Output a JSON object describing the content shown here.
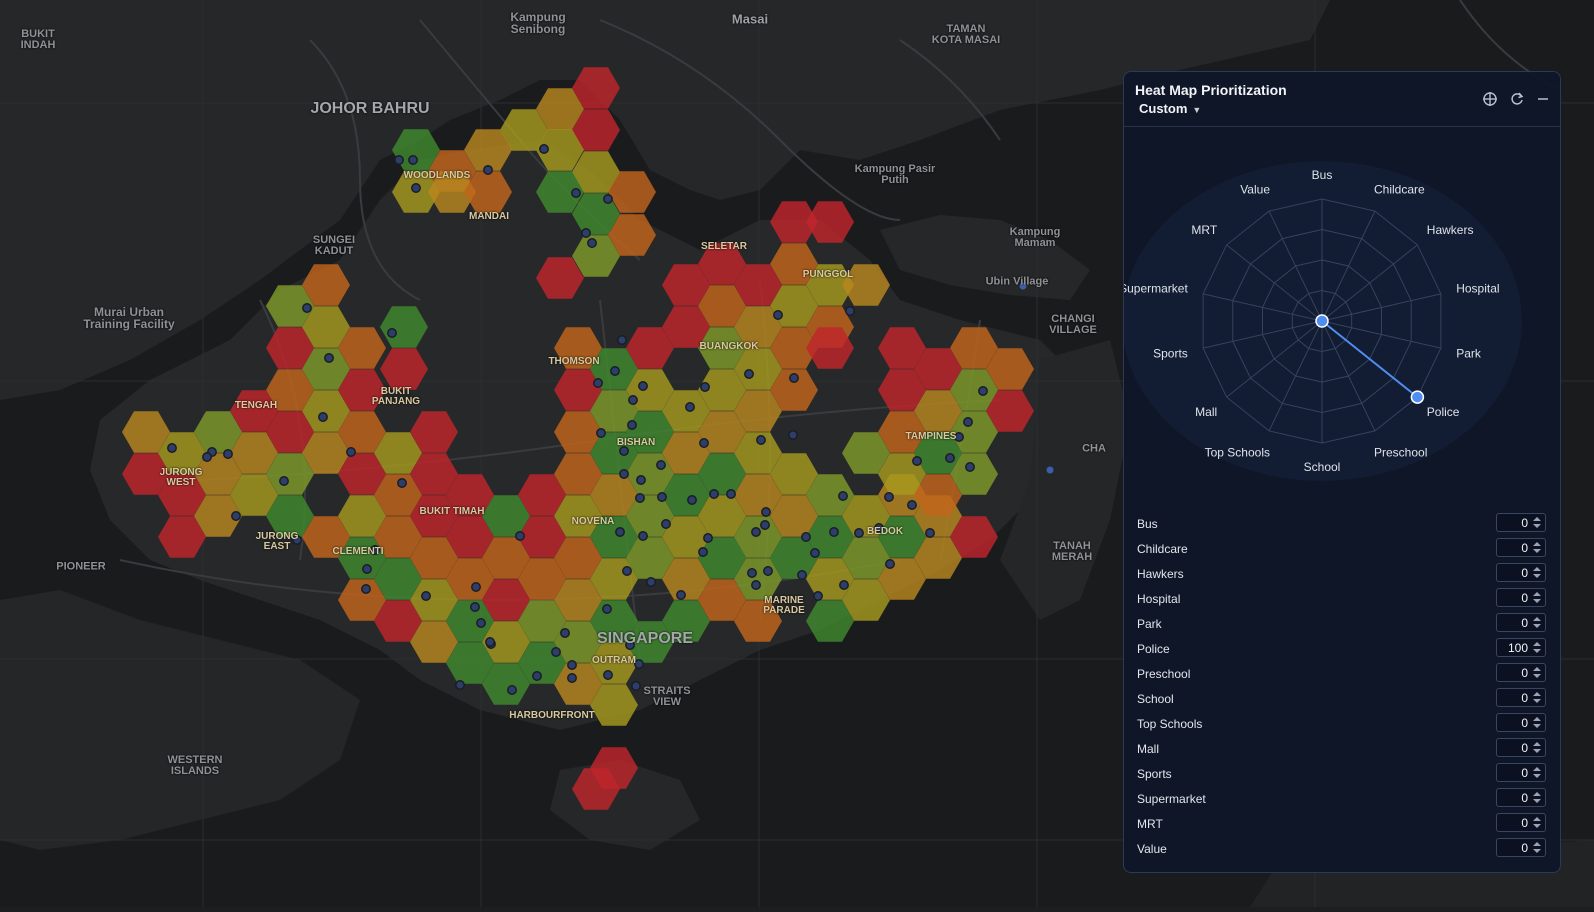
{
  "map": {
    "places": [
      {
        "key": "bukit_indah",
        "text": "BUKIT\nINDAH"
      },
      {
        "key": "kampung_senibong",
        "text": "Kampung\nSenibong"
      },
      {
        "key": "masai",
        "text": "Masai"
      },
      {
        "key": "taman_kota_masai",
        "text": "TAMAN\nKOTA MASAI"
      },
      {
        "key": "johor_bahru",
        "text": "JOHOR BAHRU"
      },
      {
        "key": "woodlands",
        "text": "WOODLANDS"
      },
      {
        "key": "mandai",
        "text": "MANDAI"
      },
      {
        "key": "kampung_pasir_putih",
        "text": "Kampung Pasir\nPutih"
      },
      {
        "key": "sungei_kadut",
        "text": "SUNGEI\nKADUT"
      },
      {
        "key": "seletar",
        "text": "SELETAR"
      },
      {
        "key": "kampung_mamam",
        "text": "Kampung\nMamam"
      },
      {
        "key": "punggol",
        "text": "PUNGGOL"
      },
      {
        "key": "ubin_village",
        "text": "Ubin Village"
      },
      {
        "key": "murai",
        "text": "Murai Urban\nTraining Facility"
      },
      {
        "key": "changi_village",
        "text": "CHANGI\nVILLAGE"
      },
      {
        "key": "thomson",
        "text": "THOMSON"
      },
      {
        "key": "buangkok",
        "text": "BUANGKOK"
      },
      {
        "key": "bukit_panjang",
        "text": "BUKIT\nPANJANG"
      },
      {
        "key": "tengah",
        "text": "TENGAH"
      },
      {
        "key": "bishan",
        "text": "BISHAN"
      },
      {
        "key": "tampines",
        "text": "TAMPINES"
      },
      {
        "key": "jurong_west",
        "text": "JURONG\nWEST"
      },
      {
        "key": "bukit_timah",
        "text": "BUKIT TIMAH"
      },
      {
        "key": "novena",
        "text": "NOVENA"
      },
      {
        "key": "bedok",
        "text": "BEDOK"
      },
      {
        "key": "jurong_east",
        "text": "JURONG\nEAST"
      },
      {
        "key": "clementi",
        "text": "CLEMENTI"
      },
      {
        "key": "tanah_merah",
        "text": "TANAH\nMERAH"
      },
      {
        "key": "pioneer",
        "text": "PIONEER"
      },
      {
        "key": "marine_parade",
        "text": "MARINE\nPARADE"
      },
      {
        "key": "singapore",
        "text": "SINGAPORE"
      },
      {
        "key": "outram",
        "text": "OUTRAM"
      },
      {
        "key": "straits_view",
        "text": "STRAITS\nVIEW"
      },
      {
        "key": "harbourfront",
        "text": "HARBOURFRONT"
      },
      {
        "key": "western_islands",
        "text": "WESTERN\nISLANDS"
      },
      {
        "key": "cha",
        "text": "CHA"
      }
    ],
    "colors": {
      "red": "#c0262c",
      "orange": "#c2651c",
      "amber": "#b8861e",
      "yellow": "#a69a1f",
      "lime": "#7f9a2a",
      "green": "#3f8a2e",
      "marker": "#3b5fa8"
    }
  },
  "panel": {
    "title": "Heat Map Prioritization",
    "preset": "Custom",
    "icons": {
      "target": "crosshair-icon",
      "reset": "reset-icon",
      "minimize": "minimize-icon"
    },
    "radar_color": "#4f8df0",
    "criteria": [
      {
        "label": "Bus",
        "value": 0
      },
      {
        "label": "Childcare",
        "value": 0
      },
      {
        "label": "Hawkers",
        "value": 0
      },
      {
        "label": "Hospital",
        "value": 0
      },
      {
        "label": "Park",
        "value": 0
      },
      {
        "label": "Police",
        "value": 100
      },
      {
        "label": "Preschool",
        "value": 0
      },
      {
        "label": "School",
        "value": 0
      },
      {
        "label": "Top Schools",
        "value": 0
      },
      {
        "label": "Mall",
        "value": 0
      },
      {
        "label": "Sports",
        "value": 0
      },
      {
        "label": "Supermarket",
        "value": 0
      },
      {
        "label": "MRT",
        "value": 0
      },
      {
        "label": "Value",
        "value": 0
      }
    ],
    "value_max": 100
  }
}
